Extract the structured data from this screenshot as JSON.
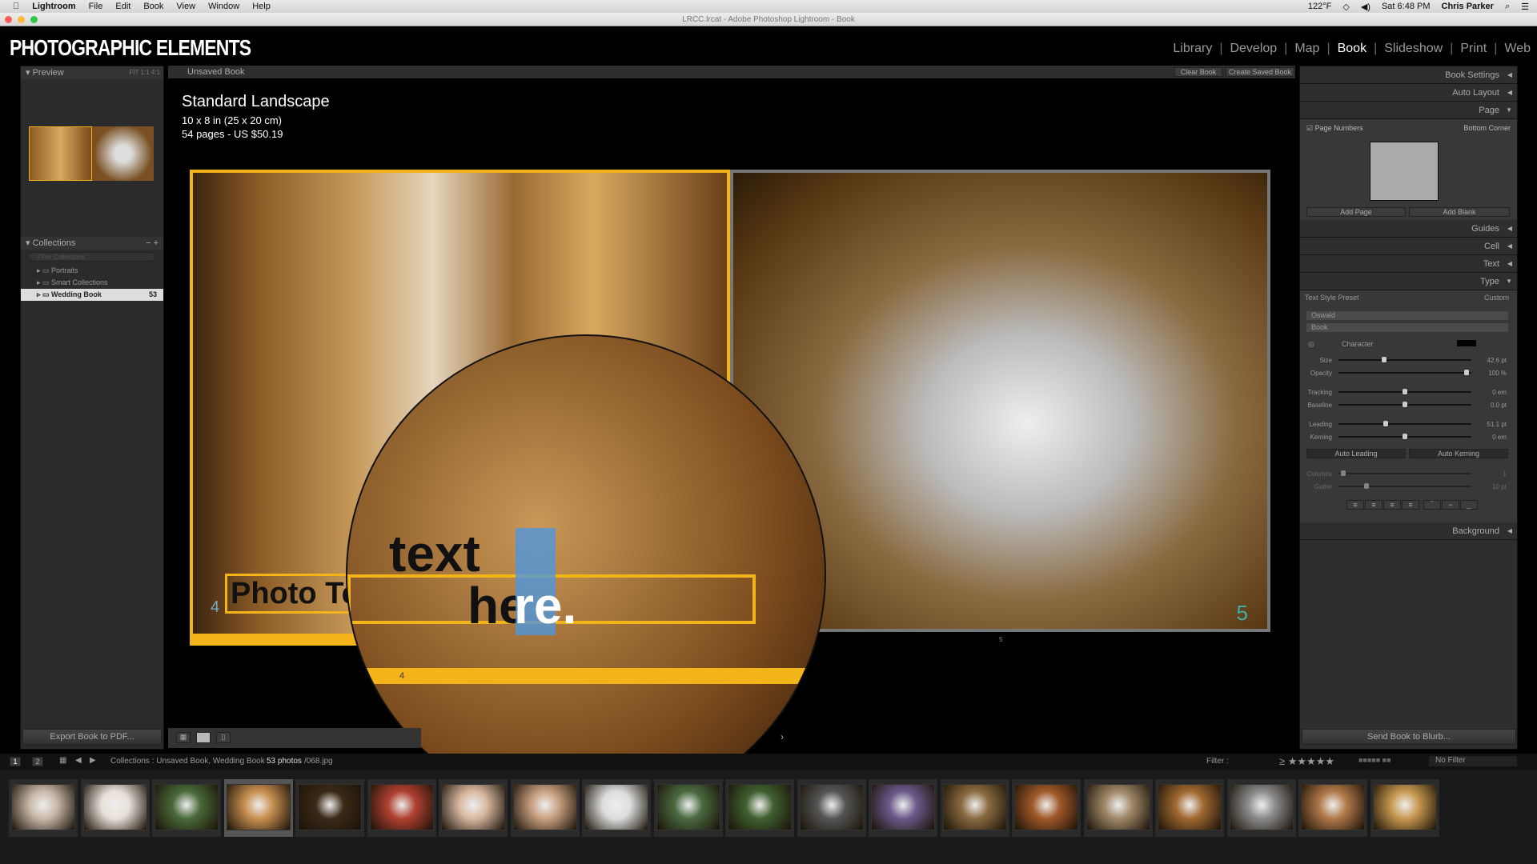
{
  "menubar": {
    "app": "Lightroom",
    "items": [
      "File",
      "Edit",
      "Book",
      "View",
      "Window",
      "Help"
    ],
    "temp": "122°F",
    "clock": "Sat 6:48 PM",
    "user": "Chris Parker"
  },
  "window": {
    "title": "LRCC.lrcat - Adobe Photoshop Lightroom - Book"
  },
  "identity": "PHOTOGRAPHIC ELEMENTS",
  "modules": [
    {
      "label": "Library"
    },
    {
      "label": "Develop"
    },
    {
      "label": "Map"
    },
    {
      "label": "Book",
      "active": true
    },
    {
      "label": "Slideshow"
    },
    {
      "label": "Print"
    },
    {
      "label": "Web"
    }
  ],
  "left": {
    "preview": {
      "title": "Preview",
      "zoom": [
        "FIT",
        "1:1",
        "4:1"
      ]
    },
    "collections": {
      "title": "Collections",
      "filter_placeholder": "Filter Collections",
      "items": [
        {
          "label": "Portraits"
        },
        {
          "label": "Smart Collections"
        },
        {
          "label": "Wedding Book",
          "count": "53",
          "selected": true
        }
      ]
    },
    "export_label": "Export Book to PDF..."
  },
  "center": {
    "book_name": "Unsaved Book",
    "clear_label": "Clear Book",
    "create_label": "Create Saved Book",
    "info": {
      "title": "Standard Landscape",
      "size": "10 x 8 in (25 x 20 cm)",
      "pages": "54 pages - US $50.19"
    },
    "page_left": "4",
    "page_right": "5",
    "spread_num": "5",
    "photo_text": "Photo Tex",
    "mag_text1": "text",
    "mag_text2": "he",
    "mag_text3": "re.",
    "mag_page": "4"
  },
  "right": {
    "sections": {
      "book_settings": "Book Settings",
      "auto_layout": "Auto Layout",
      "page": "Page",
      "guides": "Guides",
      "cell": "Cell",
      "text": "Text",
      "type": "Type",
      "background": "Background"
    },
    "page_numbers_label": "Page Numbers",
    "page_numbers_checked": true,
    "page_numbers_pos": "Bottom Corner",
    "add_page": "Add Page",
    "add_blank": "Add Blank",
    "text_style_label": "Text Style Preset",
    "text_style_value": "Custom",
    "font": "Oswald",
    "font_style": "Book",
    "character_label": "Character",
    "character_color": "#000000",
    "sliders": [
      {
        "label": "Size",
        "value": "42.6 pt",
        "pos": 0.34
      },
      {
        "label": "Opacity",
        "value": "100 %",
        "pos": 0.98
      },
      {
        "label": "Tracking",
        "value": "0 em",
        "pos": 0.5
      },
      {
        "label": "Baseline",
        "value": "0.0 pt",
        "pos": 0.5
      },
      {
        "label": "Leading",
        "value": "51.1 pt",
        "pos": 0.35
      },
      {
        "label": "Kerning",
        "value": "0 em",
        "pos": 0.5
      }
    ],
    "auto_leading": "Auto Leading",
    "auto_kerning": "Auto Kerning",
    "columns": {
      "label": "Columns",
      "value": "1",
      "pos": 0.02
    },
    "gutter": {
      "label": "Gutter",
      "value": "10 pt",
      "pos": 0.2
    },
    "send_label": "Send Book to Blurb..."
  },
  "filmstrip": {
    "pages": [
      "1",
      "2"
    ],
    "source": "Collections : Unsaved Book, Wedding Book",
    "count": "53 photos",
    "file": "/068.jpg",
    "filter_label": "Filter :",
    "filter_value": "No Filter"
  },
  "colors": {
    "accent": "#f2b418",
    "panel": "#2e2e2e"
  }
}
